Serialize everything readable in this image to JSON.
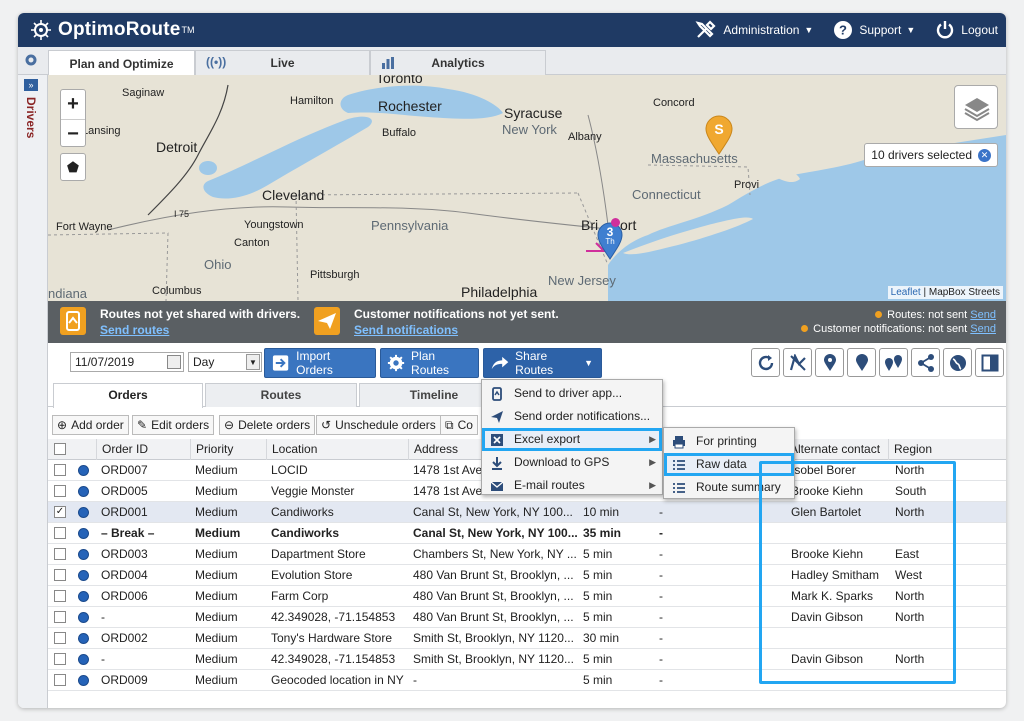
{
  "app": {
    "logo_text": "OptimoRoute",
    "logo_tm": "TM",
    "nav": [
      {
        "label": "Administration",
        "icon": "tools-icon",
        "dropdown": true
      },
      {
        "label": "Support",
        "icon": "help-icon",
        "dropdown": true
      },
      {
        "label": "Logout",
        "icon": "power-icon",
        "dropdown": false
      }
    ]
  },
  "tabs": [
    {
      "label": "Plan and Optimize",
      "icon": "gear-icon",
      "active": true
    },
    {
      "label": "Live",
      "icon": "broadcast-icon",
      "active": false
    },
    {
      "label": "Analytics",
      "icon": "bar-chart-icon",
      "active": false
    }
  ],
  "sidebar": {
    "label": "Drivers",
    "expand_glyph": "»"
  },
  "map": {
    "zoom_in": "+",
    "zoom_out": "−",
    "drivers_selected": "10 drivers selected",
    "attribution_link": "Leaflet",
    "attribution_rest": " | MapBox Streets",
    "marker_route": "3",
    "marker_route_sub": "Th",
    "marker_start": "S",
    "labels": {
      "saginaw": "Saginaw",
      "hamilton": "Hamilton",
      "toronto": "Toronto",
      "rochester": "Rochester",
      "syracuse": "Syracuse",
      "concord": "Concord",
      "lansing": "Lansing",
      "detroit": "Detroit",
      "buffalo": "Buffalo",
      "new_york": "New York",
      "albany": "Albany",
      "massachusetts": "Massachusetts",
      "cleveland": "Cleveland",
      "connecticut": "Connecticut",
      "providence": "Provi",
      "i75": "I 75",
      "fort_wayne": "Fort Wayne",
      "youngstown": "Youngstown",
      "pennsylvania": "Pennsylvania",
      "bridgeport": "Bri",
      "bridgeport_tail": "ort",
      "canton": "Canton",
      "ohio": "Ohio",
      "pittsburgh": "Pittsburgh",
      "indiana": "ndiana",
      "columbus": "Columbus",
      "philadelphia": "Philadelphia",
      "new_jersey": "New Jersey"
    }
  },
  "notifications": {
    "routes_msg": "Routes not yet shared with drivers.",
    "routes_link": "Send routes",
    "customer_msg": "Customer notifications not yet sent.",
    "customer_link": "Send notifications",
    "status_routes": "Routes: not sent",
    "status_customer": "Customer notifications: not sent",
    "send_label": "Send"
  },
  "toolbar": {
    "date": "11/07/2019",
    "period": "Day",
    "import_label": "Import Orders",
    "plan_label": "Plan Routes",
    "share_label": "Share Routes"
  },
  "view_tabs": [
    "Orders",
    "Routes",
    "Timeline"
  ],
  "actions": [
    "Add order",
    "Edit orders",
    "Delete orders",
    "Unschedule orders",
    "Co"
  ],
  "table": {
    "columns": [
      "Order ID",
      "Priority",
      "Location",
      "Address",
      "",
      "",
      "Alternate contact",
      "Region"
    ],
    "rows": [
      {
        "id": "ORD007",
        "priority": "Medium",
        "location": "LOCID",
        "address": "1478 1st Ave",
        "duration": "",
        "extra": "",
        "contact": "Isobel Borer",
        "region": "North",
        "checked": false,
        "bullet": true
      },
      {
        "id": "ORD005",
        "priority": "Medium",
        "location": "Veggie Monster",
        "address": "1478 1st Ave",
        "duration": "",
        "extra": "",
        "contact": "Brooke Kiehn",
        "region": "South",
        "checked": false,
        "bullet": true
      },
      {
        "id": "ORD001",
        "priority": "Medium",
        "location": "Candiworks",
        "address": "Canal St, New York, NY 100...",
        "duration": "10 min",
        "extra": "-",
        "contact": "Glen Bartolet",
        "region": "North",
        "checked": true,
        "bullet": true
      },
      {
        "id": "– Break –",
        "priority": "Medium",
        "location": "Candiworks",
        "address": "Canal St, New York, NY 100...",
        "duration": "35 min",
        "extra": "-",
        "contact": "",
        "region": "",
        "checked": false,
        "bullet": true
      },
      {
        "id": "ORD003",
        "priority": "Medium",
        "location": "Dapartment Store",
        "address": "Chambers St, New York, NY ...",
        "duration": "5 min",
        "extra": "-",
        "contact": "Brooke Kiehn",
        "region": "East",
        "checked": false,
        "bullet": true
      },
      {
        "id": "ORD004",
        "priority": "Medium",
        "location": "Evolution Store",
        "address": "480 Van Brunt St, Brooklyn, ...",
        "duration": "5 min",
        "extra": "-",
        "contact": "Hadley Smitham",
        "region": "West",
        "checked": false,
        "bullet": true
      },
      {
        "id": "ORD006",
        "priority": "Medium",
        "location": "Farm Corp",
        "address": "480 Van Brunt St, Brooklyn, ...",
        "duration": "5 min",
        "extra": "-",
        "contact": "Mark K. Sparks",
        "region": "North",
        "checked": false,
        "bullet": true
      },
      {
        "id": "-",
        "priority": "Medium",
        "location": "42.349028, -71.154853",
        "address": "480 Van Brunt St, Brooklyn, ...",
        "duration": "5 min",
        "extra": "-",
        "contact": "Davin Gibson",
        "region": "North",
        "checked": false,
        "bullet": true
      },
      {
        "id": "ORD002",
        "priority": "Medium",
        "location": "Tony's Hardware Store",
        "address": "Smith St, Brooklyn, NY 1120...",
        "duration": "30 min",
        "extra": "-",
        "contact": "",
        "region": "",
        "checked": false,
        "bullet": true
      },
      {
        "id": "-",
        "priority": "Medium",
        "location": "42.349028, -71.154853",
        "address": "Smith St, Brooklyn, NY 1120...",
        "duration": "5 min",
        "extra": "-",
        "contact": "Davin Gibson",
        "region": "North",
        "checked": false,
        "bullet": true
      },
      {
        "id": "ORD009",
        "priority": "Medium",
        "location": "Geocoded location in NY",
        "address": "-",
        "duration": "5 min",
        "extra": "-",
        "contact": "",
        "region": "",
        "checked": false,
        "bullet": true
      }
    ]
  },
  "share_menu": [
    {
      "label": "Send to driver app...",
      "icon": "phone-icon",
      "submenu": false
    },
    {
      "label": "Send order notifications...",
      "icon": "send-icon",
      "submenu": false
    },
    {
      "label": "Excel export",
      "icon": "excel-icon",
      "submenu": true,
      "highlight": true
    },
    {
      "label": "Download to GPS",
      "icon": "download-icon",
      "submenu": true
    },
    {
      "label": "E-mail routes",
      "icon": "email-icon",
      "submenu": true
    }
  ],
  "excel_submenu": [
    {
      "label": "For printing",
      "icon": "printer-icon"
    },
    {
      "label": "Raw data",
      "icon": "list-icon",
      "highlight": true
    },
    {
      "label": "Route summary",
      "icon": "list-icon"
    }
  ],
  "colors": {
    "topbar": "#1f3a64",
    "accent": "#3a75c0",
    "highlight": "#22a6f2",
    "warning": "#f0a020"
  }
}
